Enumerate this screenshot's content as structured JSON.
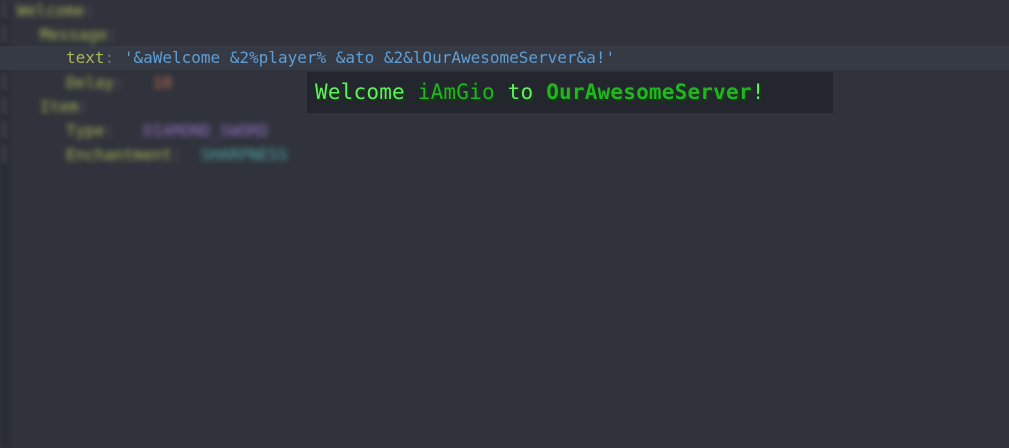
{
  "editor": {
    "lines": [
      {
        "key": "Welcome",
        "sep": ":"
      },
      {
        "key": "Message",
        "sep": ":"
      },
      {
        "key": "text",
        "sep": ":",
        "value": "'&aWelcome &2%player% &ato &2&lOurAwesomeServer&a!'"
      },
      {
        "key": "Delay",
        "sep": ":",
        "value": "10"
      },
      {
        "key": "Item",
        "sep": ":"
      },
      {
        "key": "Type",
        "sep": ":",
        "value": "DIAMOND_SWORD"
      },
      {
        "key": "Enchantment",
        "sep": ":",
        "value": "SHARPNESS"
      }
    ]
  },
  "preview": {
    "segments": [
      {
        "text": "Welcome ",
        "color": "#5ef25e"
      },
      {
        "text": "iAmGio",
        "color": "#1fb61f"
      },
      {
        "text": " to ",
        "color": "#5ef25e"
      },
      {
        "text": "OurAwesomeServer",
        "color": "#1fb61f",
        "bold": true
      },
      {
        "text": "!",
        "color": "#5ef25e"
      }
    ]
  }
}
